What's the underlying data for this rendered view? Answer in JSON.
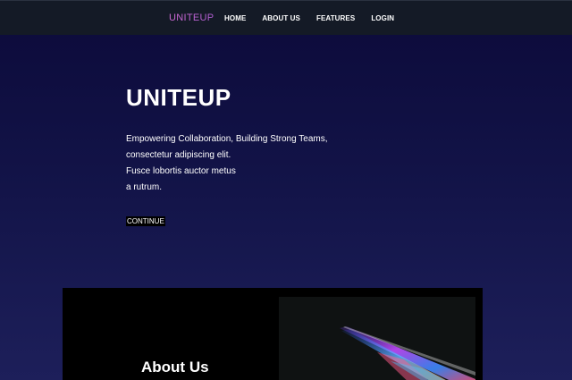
{
  "header": {
    "brand": "UNITEUP",
    "nav": [
      {
        "label": "HOME"
      },
      {
        "label": "ABOUT US"
      },
      {
        "label": "FEATURES"
      },
      {
        "label": "LOGIN"
      }
    ]
  },
  "hero": {
    "title": "UNITEUP",
    "lines": [
      "Empowering Collaboration, Building Strong Teams,",
      "consectetur adipiscing elit.",
      "Fusce lobortis auctor metus",
      "a rutrum."
    ],
    "button_label": "CONTINUE"
  },
  "about": {
    "title": "About Us",
    "image_icon": "abstract-light-streak-image"
  },
  "colors": {
    "nav_bg": "#141a26",
    "brand_gradient": [
      "#d36bd8",
      "#b05ed3"
    ],
    "hero_bg_top": "#0c0a3a",
    "hero_bg_bottom": "#1d1f5a",
    "about_bg": "#000000"
  }
}
